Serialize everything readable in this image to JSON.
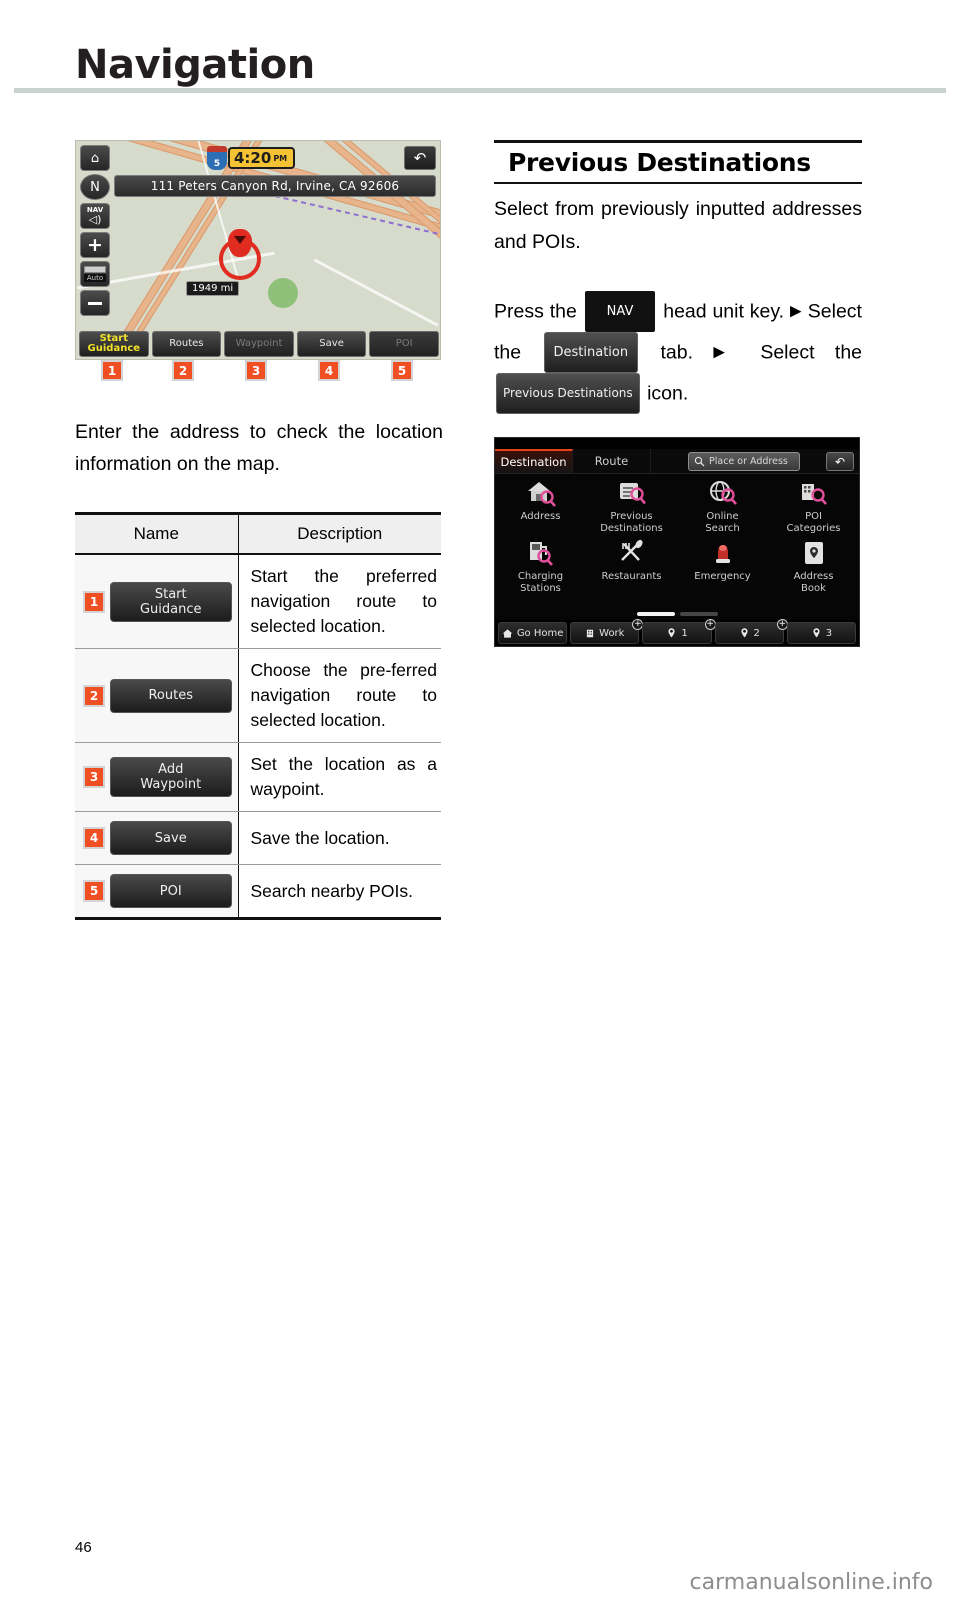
{
  "header": {
    "title": "Navigation"
  },
  "map_screen": {
    "address_bar": "111 Peters Canyon Rd, Irvine, CA 92606",
    "clock": "4:20",
    "clock_ampm": "PM",
    "shield_label": "5",
    "distance_badge": "1949 mi",
    "back_icon": "↶",
    "side_buttons": [
      {
        "name": "home-icon",
        "glyph": "⌂"
      },
      {
        "name": "compass-north-icon",
        "glyph": "N"
      },
      {
        "name": "nav-volume-icon",
        "label": "NAV",
        "glyph": "◁))"
      },
      {
        "name": "zoom-in-icon",
        "glyph": "+"
      },
      {
        "name": "map-scale-auto",
        "label": "Auto"
      },
      {
        "name": "zoom-out-icon",
        "glyph": "−"
      }
    ],
    "toolbar": [
      {
        "label": "Start\nGuidance",
        "state": "active"
      },
      {
        "label": "Routes",
        "state": "normal"
      },
      {
        "label": "Waypoint",
        "state": "disabled"
      },
      {
        "label": "Save",
        "state": "normal"
      },
      {
        "label": "POI",
        "state": "disabled"
      }
    ],
    "callouts": [
      "1",
      "2",
      "3",
      "4",
      "5"
    ]
  },
  "left_paragraph": "Enter the address to check the location information on the map.",
  "table": {
    "headers": [
      "Name",
      "Description"
    ],
    "rows": [
      {
        "num": "1",
        "button": "Start\nGuidance",
        "desc": "Start the preferred navigation route to selected location."
      },
      {
        "num": "2",
        "button": "Routes",
        "desc": "Choose the pre-ferred navigation route to selected location."
      },
      {
        "num": "3",
        "button": "Add\nWaypoint",
        "desc": "Set the location as a waypoint."
      },
      {
        "num": "4",
        "button": "Save",
        "desc": "Save the location."
      },
      {
        "num": "5",
        "button": "POI",
        "desc": "Search nearby POIs."
      }
    ]
  },
  "right": {
    "section_title": "Previous Destinations",
    "intro": "Select from previously inputted addresses and POIs.",
    "step_press": "Press the",
    "key_nav": "NAV",
    "step_headunit": "head unit key.",
    "arrow": "▶",
    "step_select1": "Select the",
    "tab_destination": "Destination",
    "step_tab": "tab.",
    "step_select2": "Select",
    "step_the": "the",
    "icon_previous_destinations": "Previous Destinations",
    "step_icon": "icon."
  },
  "dest_screen": {
    "tabs": [
      {
        "label": "Destination",
        "selected": true
      },
      {
        "label": "Route",
        "selected": false
      }
    ],
    "search_placeholder": "Place or Address",
    "search_icon": "search-icon",
    "back_icon": "↶",
    "items": [
      {
        "label": "Address",
        "icon": "home-search-icon"
      },
      {
        "label": "Previous\nDestinations",
        "icon": "document-search-icon"
      },
      {
        "label": "Online\nSearch",
        "icon": "globe-search-icon"
      },
      {
        "label": "POI\nCategories",
        "icon": "building-search-icon"
      },
      {
        "label": "Charging\nStations",
        "icon": "charging-station-icon"
      },
      {
        "label": "Restaurants",
        "icon": "cutlery-icon"
      },
      {
        "label": "Emergency",
        "icon": "emergency-beacon-icon"
      },
      {
        "label": "Address\nBook",
        "icon": "address-book-icon"
      }
    ],
    "page_dots": 2,
    "page_current": 1,
    "bottom_bar": [
      {
        "label": "Go Home",
        "icon": "home-icon",
        "add": false
      },
      {
        "label": "Work",
        "icon": "office-icon",
        "add": true
      },
      {
        "label": "1",
        "icon": "favorite-pin-icon",
        "add": true
      },
      {
        "label": "2",
        "icon": "favorite-pin-icon",
        "add": true
      },
      {
        "label": "3",
        "icon": "favorite-pin-icon",
        "add": false
      }
    ]
  },
  "footer": {
    "page_number": "46",
    "watermark": "carmanualsonline.info"
  },
  "colors": {
    "accent": "#f04e23",
    "tab_accent": "#e0431c",
    "rule": "#c9d3cd"
  }
}
